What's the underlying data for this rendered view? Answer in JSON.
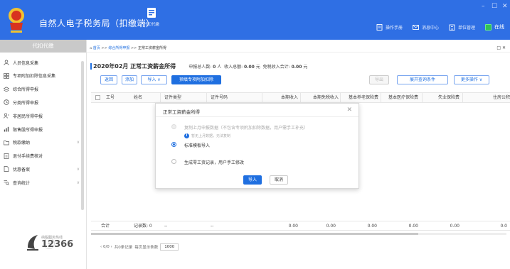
{
  "header": {
    "app_title": "自然人电子税务局（扣缴端）",
    "module_label": "代扣代缴",
    "window_controls": [
      "–",
      "☐",
      "✕"
    ],
    "links": [
      {
        "icon": "document-icon",
        "label": "操作手册"
      },
      {
        "icon": "message-icon",
        "label": "消息中心"
      },
      {
        "icon": "building-icon",
        "label": "单位管理"
      }
    ],
    "online_label": "在线"
  },
  "sidebar": {
    "title": "代扣代缴",
    "items": [
      {
        "icon": "person-icon",
        "label": "人员信息采集",
        "chevron": false
      },
      {
        "icon": "grid-icon",
        "label": "专项附加扣除信息采集",
        "chevron": false
      },
      {
        "icon": "layers-icon",
        "label": "综合所得申报",
        "chevron": false
      },
      {
        "icon": "clock-icon",
        "label": "分类所得申报",
        "chevron": false
      },
      {
        "icon": "person-outline-icon",
        "label": "非居民所得申报",
        "chevron": false
      },
      {
        "icon": "bar-chart-icon",
        "label": "限售股所得申报",
        "chevron": false
      },
      {
        "icon": "folder-icon",
        "label": "税款缴纳",
        "chevron": true
      },
      {
        "icon": "receipt-icon",
        "label": "退付手续费核对",
        "chevron": false
      },
      {
        "icon": "file-icon",
        "label": "优惠备案",
        "chevron": true
      },
      {
        "icon": "search-list-icon",
        "label": "查询统计",
        "chevron": true
      }
    ],
    "collapse_label": "«",
    "hotline_small": "纳税服务热线",
    "hotline": "12366"
  },
  "breadcrumb": {
    "home": "首页",
    "sep": ">>",
    "parent": "综合所得申报",
    "current": "正常工资薪金所得",
    "close": "□ ✕"
  },
  "summary": {
    "period": "2020年02月 正常工资薪金所得",
    "stat_prefix": "申报总人数:",
    "count": "0",
    "count_unit": "人",
    "income_prefix": "收入总额:",
    "income": "0.00",
    "income_unit": "元",
    "taxfree_prefix": "免税收入合计:",
    "taxfree": "0.00",
    "taxfree_unit": "元"
  },
  "toolbar": {
    "back": "返回",
    "add": "添加",
    "import": "导入 ∨",
    "prefill": "预填专项附加扣除",
    "export": "导出",
    "expand_query": "展开查询条件",
    "more": "更多操作 ∨"
  },
  "table": {
    "headers": [
      "工号",
      "姓名",
      "证件类型",
      "证件号码",
      "本期收入",
      "本期免税收入",
      "基本养老保险费",
      "基本医疗保险费",
      "失业保险费",
      "住房公积"
    ],
    "footer": {
      "total_label": "合计",
      "record_label": "记录数: 0",
      "dash1": "--",
      "dash2": "--",
      "values": [
        "0.00",
        "0.00",
        "0.00",
        "0.00",
        "0.00",
        "0.0"
      ]
    }
  },
  "pager": {
    "nav": "‹ 0/0 ›",
    "total": "共0条记录",
    "per_page_label": "每页显示条数",
    "per_page": "1000"
  },
  "dialog": {
    "title": "正常工资薪金所得",
    "close": "✕",
    "options": [
      {
        "label": "复制上月申报数据（不包含专项附加扣除数据，用户需手工补充）",
        "selected": false,
        "disabled": true
      },
      {
        "label": "标准模板导入",
        "selected": true,
        "disabled": false
      },
      {
        "label": "生成零工资记录，用户手工修改",
        "selected": false,
        "disabled": false
      }
    ],
    "hint": "暂无上月数据，无法复制",
    "confirm": "导入",
    "cancel": "取消"
  },
  "colors": {
    "header_blue": "#2f6fe4",
    "accent": "#1f6fe0",
    "online_green": "#33c058"
  }
}
